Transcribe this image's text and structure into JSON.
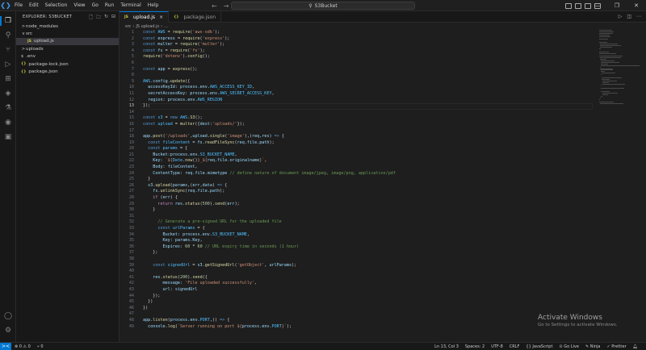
{
  "titlebar": {
    "menu": [
      "File",
      "Edit",
      "Selection",
      "View",
      "Go",
      "Run",
      "Terminal",
      "Help"
    ],
    "search_text": "S3Bucket"
  },
  "explorer": {
    "header": "EXPLORER: S3BUCKET",
    "items": [
      {
        "label": "node_modules",
        "type": "folder",
        "chevron": ">",
        "indent": 0,
        "selected": false
      },
      {
        "label": "src",
        "type": "folder",
        "chevron": "v",
        "indent": 0,
        "selected": false
      },
      {
        "label": "upload.js",
        "type": "file",
        "badge": "JS",
        "indent": 1,
        "selected": true
      },
      {
        "label": "uploads",
        "type": "folder",
        "chevron": ">",
        "indent": 0,
        "selected": false
      },
      {
        "label": ".env",
        "type": "file",
        "badge": "$",
        "indent": 0,
        "selected": false
      },
      {
        "label": "package-lock.json",
        "type": "file",
        "badge": "{}",
        "indent": 0,
        "selected": false
      },
      {
        "label": "package.json",
        "type": "file",
        "badge": "{}",
        "indent": 0,
        "selected": false
      }
    ]
  },
  "tabs": [
    {
      "label": "upload.js",
      "badge": "JS",
      "active": true
    },
    {
      "label": "package.json",
      "badge": "{}",
      "active": false
    }
  ],
  "breadcrumb": [
    "src",
    "JS upload.js",
    "..."
  ],
  "editor": {
    "current_line": 13,
    "lines": [
      [
        [
          "const ",
          "kw"
        ],
        [
          "AWS",
          "const"
        ],
        [
          " = ",
          "p"
        ],
        [
          "require",
          "fn"
        ],
        [
          "(",
          "p"
        ],
        [
          "'aws-sdk'",
          "str"
        ],
        [
          ");",
          "p"
        ]
      ],
      [
        [
          "const ",
          "kw"
        ],
        [
          "express",
          "var"
        ],
        [
          " = ",
          "p"
        ],
        [
          "require",
          "fn"
        ],
        [
          "(",
          "p"
        ],
        [
          "'express'",
          "str"
        ],
        [
          ");",
          "p"
        ]
      ],
      [
        [
          "const ",
          "kw"
        ],
        [
          "multer",
          "var"
        ],
        [
          " = ",
          "p"
        ],
        [
          "require",
          "fn"
        ],
        [
          "(",
          "p"
        ],
        [
          "'multer'",
          "str"
        ],
        [
          ");",
          "p"
        ]
      ],
      [
        [
          "const ",
          "kw"
        ],
        [
          "fs",
          "var"
        ],
        [
          " = ",
          "p"
        ],
        [
          "require",
          "fn"
        ],
        [
          "(",
          "p"
        ],
        [
          "'fs'",
          "str"
        ],
        [
          ");",
          "p"
        ]
      ],
      [
        [
          "require",
          "fn"
        ],
        [
          "(",
          "p"
        ],
        [
          "'dotenv'",
          "str"
        ],
        [
          ").",
          "p"
        ],
        [
          "config",
          "fn"
        ],
        [
          "();",
          "p"
        ]
      ],
      [
        [
          "",
          "p"
        ]
      ],
      [
        [
          "const ",
          "kw"
        ],
        [
          "app",
          "var"
        ],
        [
          " = ",
          "p"
        ],
        [
          "express",
          "fn"
        ],
        [
          "();",
          "p"
        ]
      ],
      [
        [
          "",
          "p"
        ]
      ],
      [
        [
          "AWS",
          "const"
        ],
        [
          ".",
          "p"
        ],
        [
          "config",
          "var"
        ],
        [
          ".",
          "p"
        ],
        [
          "update",
          "fn"
        ],
        [
          "({",
          "p"
        ]
      ],
      [
        [
          "  accessKeyId",
          "var"
        ],
        [
          ": ",
          "p"
        ],
        [
          "process",
          "var"
        ],
        [
          ".",
          "p"
        ],
        [
          "env",
          "var"
        ],
        [
          ".",
          "p"
        ],
        [
          "AWS_ACCESS_KEY_ID",
          "const"
        ],
        [
          ",",
          "p"
        ]
      ],
      [
        [
          "  secretAccessKey",
          "var"
        ],
        [
          ": ",
          "p"
        ],
        [
          "process",
          "var"
        ],
        [
          ".",
          "p"
        ],
        [
          "env",
          "var"
        ],
        [
          ".",
          "p"
        ],
        [
          "AWS_SECRET_ACCESS_KEY",
          "const"
        ],
        [
          ",",
          "p"
        ]
      ],
      [
        [
          "  region",
          "var"
        ],
        [
          ": ",
          "p"
        ],
        [
          "process",
          "var"
        ],
        [
          ".",
          "p"
        ],
        [
          "env",
          "var"
        ],
        [
          ".",
          "p"
        ],
        [
          "AWS_REGION",
          "const"
        ]
      ],
      [
        [
          "});",
          "p"
        ]
      ],
      [
        [
          "",
          "p"
        ]
      ],
      [
        [
          "const ",
          "kw"
        ],
        [
          "s3",
          "const"
        ],
        [
          " = ",
          "p"
        ],
        [
          "new ",
          "kw"
        ],
        [
          "AWS",
          "const"
        ],
        [
          ".",
          "p"
        ],
        [
          "S3",
          "fn"
        ],
        [
          "();",
          "p"
        ]
      ],
      [
        [
          "const ",
          "kw"
        ],
        [
          "upload",
          "const"
        ],
        [
          " = ",
          "p"
        ],
        [
          "multer",
          "fn"
        ],
        [
          "({",
          "p"
        ],
        [
          "dest",
          "var"
        ],
        [
          ":",
          "p"
        ],
        [
          "'uploads/'",
          "str"
        ],
        [
          "});",
          "p"
        ]
      ],
      [
        [
          "",
          "p"
        ]
      ],
      [
        [
          "app",
          "var"
        ],
        [
          ".",
          "p"
        ],
        [
          "post",
          "fn"
        ],
        [
          "(",
          "p"
        ],
        [
          "'/uploads'",
          "str"
        ],
        [
          ",",
          "p"
        ],
        [
          "upload",
          "var"
        ],
        [
          ".",
          "p"
        ],
        [
          "single",
          "fn"
        ],
        [
          "(",
          "p"
        ],
        [
          "'image'",
          "str"
        ],
        [
          "),(",
          "p"
        ],
        [
          "req",
          "var"
        ],
        [
          ",",
          "p"
        ],
        [
          "res",
          "var"
        ],
        [
          ") ",
          "p"
        ],
        [
          "=>",
          "kw"
        ],
        [
          " {",
          "p"
        ]
      ],
      [
        [
          "  const ",
          "kw"
        ],
        [
          "fileContent",
          "const"
        ],
        [
          " = ",
          "p"
        ],
        [
          "fs",
          "var"
        ],
        [
          ".",
          "p"
        ],
        [
          "readFileSync",
          "fn"
        ],
        [
          "(",
          "p"
        ],
        [
          "req",
          "var"
        ],
        [
          ".",
          "p"
        ],
        [
          "file",
          "var"
        ],
        [
          ".",
          "p"
        ],
        [
          "path",
          "var"
        ],
        [
          ");",
          "p"
        ]
      ],
      [
        [
          "  const ",
          "kw"
        ],
        [
          "params",
          "const"
        ],
        [
          " = {",
          "p"
        ]
      ],
      [
        [
          "    Bucket",
          "var"
        ],
        [
          ":",
          "p"
        ],
        [
          "process",
          "var"
        ],
        [
          ".",
          "p"
        ],
        [
          "env",
          "var"
        ],
        [
          ".",
          "p"
        ],
        [
          "S3_BUCKET_NAME",
          "const"
        ],
        [
          ",",
          "p"
        ]
      ],
      [
        [
          "    Key",
          "var"
        ],
        [
          ": ",
          "p"
        ],
        [
          "`${",
          "str"
        ],
        [
          "Date",
          "const"
        ],
        [
          ".",
          "p"
        ],
        [
          "now",
          "fn"
        ],
        [
          "()",
          "p"
        ],
        [
          "}_${",
          "str"
        ],
        [
          "req",
          "var"
        ],
        [
          ".",
          "p"
        ],
        [
          "file",
          "var"
        ],
        [
          ".",
          "p"
        ],
        [
          "originalname",
          "var"
        ],
        [
          "}`",
          "str"
        ],
        [
          ",",
          "p"
        ]
      ],
      [
        [
          "    Body",
          "var"
        ],
        [
          ": ",
          "p"
        ],
        [
          "fileContent",
          "var"
        ],
        [
          ",",
          "p"
        ]
      ],
      [
        [
          "    ContentType",
          "var"
        ],
        [
          ": ",
          "p"
        ],
        [
          "req",
          "var"
        ],
        [
          ".",
          "p"
        ],
        [
          "file",
          "var"
        ],
        [
          ".",
          "p"
        ],
        [
          "mimetype",
          "var"
        ],
        [
          " ",
          "p"
        ],
        [
          "// define nature of document image/jpeg, image/png, application/pdf",
          "com"
        ]
      ],
      [
        [
          "  }",
          "p"
        ]
      ],
      [
        [
          "  s3",
          "var"
        ],
        [
          ".",
          "p"
        ],
        [
          "upload",
          "fn"
        ],
        [
          "(",
          "p"
        ],
        [
          "params",
          "var"
        ],
        [
          ",(",
          "p"
        ],
        [
          "err",
          "var"
        ],
        [
          ",",
          "p"
        ],
        [
          "data",
          "var"
        ],
        [
          ") ",
          "p"
        ],
        [
          "=>",
          "kw"
        ],
        [
          " {",
          "p"
        ]
      ],
      [
        [
          "    fs",
          "var"
        ],
        [
          ".",
          "p"
        ],
        [
          "unlinkSync",
          "fn"
        ],
        [
          "(",
          "p"
        ],
        [
          "req",
          "var"
        ],
        [
          ".",
          "p"
        ],
        [
          "file",
          "var"
        ],
        [
          ".",
          "p"
        ],
        [
          "path",
          "var"
        ],
        [
          ");",
          "p"
        ]
      ],
      [
        [
          "    ",
          "p"
        ],
        [
          "if",
          "ctl"
        ],
        [
          " (",
          "p"
        ],
        [
          "err",
          "var"
        ],
        [
          ") {",
          "p"
        ]
      ],
      [
        [
          "      ",
          "p"
        ],
        [
          "return",
          "ctl"
        ],
        [
          " ",
          "p"
        ],
        [
          "res",
          "var"
        ],
        [
          ".",
          "p"
        ],
        [
          "status",
          "fn"
        ],
        [
          "(",
          "p"
        ],
        [
          "500",
          "num"
        ],
        [
          ").",
          "p"
        ],
        [
          "send",
          "fn"
        ],
        [
          "(",
          "p"
        ],
        [
          "err",
          "var"
        ],
        [
          ");",
          "p"
        ]
      ],
      [
        [
          "    }",
          "p"
        ]
      ],
      [
        [
          "",
          "p"
        ]
      ],
      [
        [
          "      ",
          "p"
        ],
        [
          "// Generate a pre-signed URL for the uploaded file",
          "com"
        ]
      ],
      [
        [
          "      const ",
          "kw"
        ],
        [
          "urlParams",
          "const"
        ],
        [
          " = {",
          "p"
        ]
      ],
      [
        [
          "        Bucket",
          "var"
        ],
        [
          ": ",
          "p"
        ],
        [
          "process",
          "var"
        ],
        [
          ".",
          "p"
        ],
        [
          "env",
          "var"
        ],
        [
          ".",
          "p"
        ],
        [
          "S3_BUCKET_NAME",
          "const"
        ],
        [
          ",",
          "p"
        ]
      ],
      [
        [
          "        Key",
          "var"
        ],
        [
          ": ",
          "p"
        ],
        [
          "params",
          "var"
        ],
        [
          ".",
          "p"
        ],
        [
          "Key",
          "var"
        ],
        [
          ",",
          "p"
        ]
      ],
      [
        [
          "        Expires",
          "var"
        ],
        [
          ": ",
          "p"
        ],
        [
          "60",
          "num"
        ],
        [
          " * ",
          "p"
        ],
        [
          "60",
          "num"
        ],
        [
          " ",
          "p"
        ],
        [
          "// URL expiry time in seconds (1 hour)",
          "com"
        ]
      ],
      [
        [
          "    };",
          "p"
        ]
      ],
      [
        [
          "",
          "p"
        ]
      ],
      [
        [
          "    const ",
          "kw"
        ],
        [
          "signedUrl",
          "const"
        ],
        [
          " = ",
          "p"
        ],
        [
          "s3",
          "var"
        ],
        [
          ".",
          "p"
        ],
        [
          "getSignedUrl",
          "fn"
        ],
        [
          "(",
          "p"
        ],
        [
          "'getObject'",
          "str"
        ],
        [
          ", ",
          "p"
        ],
        [
          "urlParams",
          "var"
        ],
        [
          ");",
          "p"
        ]
      ],
      [
        [
          "",
          "p"
        ]
      ],
      [
        [
          "    res",
          "var"
        ],
        [
          ".",
          "p"
        ],
        [
          "status",
          "fn"
        ],
        [
          "(",
          "p"
        ],
        [
          "200",
          "num"
        ],
        [
          ").",
          "p"
        ],
        [
          "send",
          "fn"
        ],
        [
          "({",
          "p"
        ]
      ],
      [
        [
          "        message",
          "var"
        ],
        [
          ": ",
          "p"
        ],
        [
          "'File uploaded successfully'",
          "str"
        ],
        [
          ",",
          "p"
        ]
      ],
      [
        [
          "        url",
          "var"
        ],
        [
          ": ",
          "p"
        ],
        [
          "signedUrl",
          "var"
        ]
      ],
      [
        [
          "    });",
          "p"
        ]
      ],
      [
        [
          "  })",
          "p"
        ]
      ],
      [
        [
          "})",
          "p"
        ]
      ],
      [
        [
          "",
          "p"
        ]
      ],
      [
        [
          "app",
          "var"
        ],
        [
          ".",
          "p"
        ],
        [
          "listen",
          "fn"
        ],
        [
          "(",
          "p"
        ],
        [
          "process",
          "var"
        ],
        [
          ".",
          "p"
        ],
        [
          "env",
          "var"
        ],
        [
          ".",
          "p"
        ],
        [
          "PORT",
          "const"
        ],
        [
          ",() ",
          "p"
        ],
        [
          "=>",
          "kw"
        ],
        [
          " {",
          "p"
        ]
      ],
      [
        [
          "  console",
          "var"
        ],
        [
          ".",
          "p"
        ],
        [
          "log",
          "fn"
        ],
        [
          "(",
          "p"
        ],
        [
          "`Server running on port ${",
          "str"
        ],
        [
          "process",
          "var"
        ],
        [
          ".",
          "p"
        ],
        [
          "env",
          "var"
        ],
        [
          ".",
          "p"
        ],
        [
          "PORT",
          "const"
        ],
        [
          "}`",
          "str"
        ],
        [
          ");",
          "p"
        ]
      ]
    ]
  },
  "watermark": {
    "title": "Activate Windows",
    "subtitle": "Go to Settings to activate Windows."
  },
  "statusbar": {
    "remote": "><",
    "problems": "⊗ 0 ⚠ 0",
    "ports": "⑂ 0",
    "cursor": "Ln 13, Col 3",
    "spaces": "Spaces: 2",
    "encoding": "UTF-8",
    "eol": "CRLF",
    "language": "{} JavaScript",
    "golive": "⊙ Go Live",
    "ninja": "✎ Ninja",
    "prettier": "✓ Prettier"
  },
  "colors": {
    "accent": "#0078d4",
    "editor_bg": "#1e1e1e",
    "sidebar_bg": "#181818"
  }
}
